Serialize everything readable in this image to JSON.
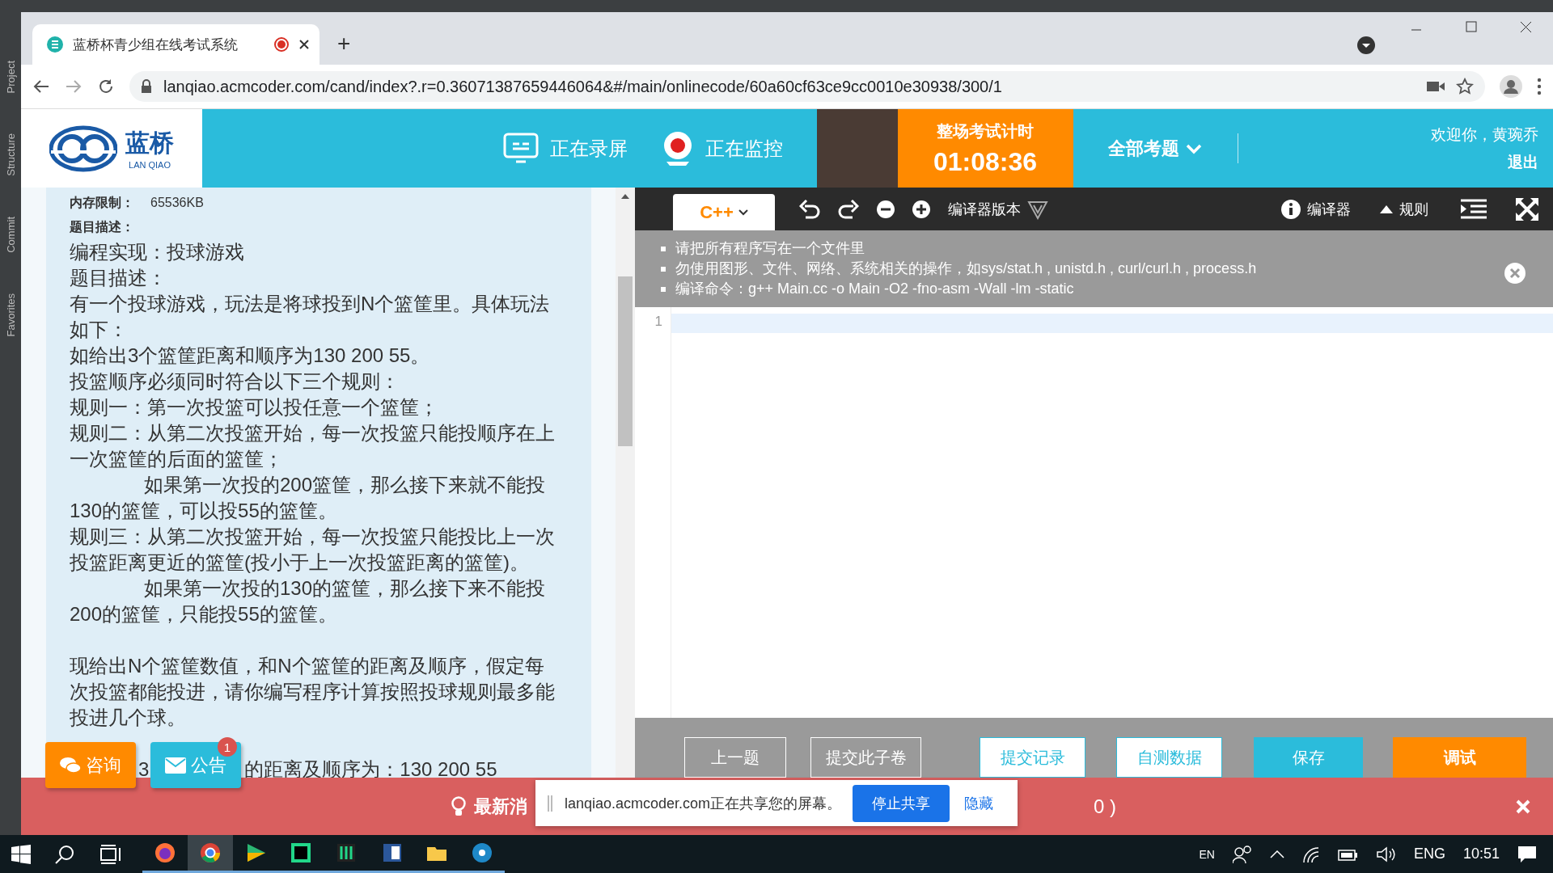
{
  "ide": {
    "side_tabs": [
      "Project",
      "Structure",
      "Commit",
      "Favorites"
    ]
  },
  "browser": {
    "tab": {
      "title": "蓝桥杯青少组在线考试系统",
      "recording": true
    },
    "new_tab": "+",
    "url": "lanqiao.acmcoder.com/cand/index?.r=0.36071387659446064&#/main/onlinecode/60a60cf63ce9cc0010e30938/300/1"
  },
  "header": {
    "logo": {
      "name": "蓝桥",
      "latin": "LAN QIAO"
    },
    "status": [
      {
        "kind": "screen",
        "label": "正在录屏"
      },
      {
        "kind": "camera",
        "label": "正在监控"
      }
    ],
    "timer": {
      "label": "整场考试计时",
      "value": "01:08:36"
    },
    "all_questions": "全部考题",
    "welcome": "欢迎你，黄琬乔",
    "logout": "退出"
  },
  "problem": {
    "memory_label": "内存限制：",
    "memory_value": "65536KB",
    "desc_label": "题目描述：",
    "paragraphs": [
      {
        "kind": "line",
        "text": "编程实现：投球游戏"
      },
      {
        "kind": "line",
        "text": "题目描述："
      },
      {
        "kind": "line",
        "text": "有一个投球游戏，玩法是将球投到N个篮筐里。具体玩法如下："
      },
      {
        "kind": "line",
        "text": "如给出3个篮筐距离和顺序为130 200 55。"
      },
      {
        "kind": "line",
        "text": "投篮顺序必须同时符合以下三个规则："
      },
      {
        "kind": "line",
        "text": "规则一：第一次投篮可以投任意一个篮筐；"
      },
      {
        "kind": "line",
        "text": "规则二：从第二次投篮开始，每一次投篮只能投顺序在上一次篮筐的后面的篮筐；"
      },
      {
        "kind": "indented",
        "text": "如果第一次投的200篮筐，那么接下来就不能投130的篮筐，可以投55的篮筐。"
      },
      {
        "kind": "line",
        "text": "规则三：从第二次投篮开始，每一次投篮只能投比上一次投篮距离更近的篮筐(投小于上一次投篮距离的篮筐)。"
      },
      {
        "kind": "indented",
        "text": "如果第一次投的130的篮筐，那么接下来不能投200的篮筐，只能投55的篮筐。"
      },
      {
        "kind": "new_section",
        "text": "现给出N个篮筐数值，和N个篮筐的距离及顺序，假定每次投篮都能投进，请你编写程序计算按照投球规则最多能投进几个球。"
      }
    ],
    "partial_line": [
      "3",
      "的距离及顺序为：130 200 55"
    ]
  },
  "floating_buttons": [
    {
      "kind": "consult",
      "label": "咨询"
    },
    {
      "kind": "notice",
      "label": "公告",
      "badge": "1"
    }
  ],
  "editor": {
    "language": "C++",
    "version_label": "编译器版本",
    "compiler": "编译器",
    "rules": "规则",
    "notices": [
      "请把所有程序写在一个文件里",
      "勿使用图形、文件、网络、系统相关的操作，如sys/stat.h , unistd.h , curl/curl.h , process.h",
      "编译命令：g++ Main.cc -o Main -O2 -fno-asm -Wall -lm -static"
    ],
    "line_numbers": [
      "1"
    ],
    "buttons": [
      {
        "kind": "outline_gray",
        "label": "上一题"
      },
      {
        "kind": "outline_gray",
        "label": "提交此子卷"
      },
      {
        "kind": "outline_blue",
        "label": "提交记录"
      },
      {
        "kind": "outline_blue",
        "label": "自测数据"
      },
      {
        "kind": "solid_blue",
        "label": "保存"
      },
      {
        "kind": "solid_orange",
        "label": "调试"
      }
    ]
  },
  "news_bar": {
    "label": "最新消",
    "tail": "0 )"
  },
  "share_popup": {
    "message": "lanqiao.acmcoder.com正在共享您的屏幕。",
    "stop": "停止共享",
    "hide": "隐藏"
  },
  "taskbar": {
    "apps": [
      {
        "kind": "firefox",
        "selected": false
      },
      {
        "kind": "chrome",
        "selected": true
      },
      {
        "kind": "player",
        "selected": false
      },
      {
        "kind": "clion",
        "selected": false
      },
      {
        "kind": "tool",
        "selected": false
      },
      {
        "kind": "word",
        "selected": false
      },
      {
        "kind": "folder",
        "selected": false
      },
      {
        "kind": "disc",
        "selected": false
      }
    ],
    "input_method": "EN",
    "language": "ENG",
    "time": "10:51"
  }
}
